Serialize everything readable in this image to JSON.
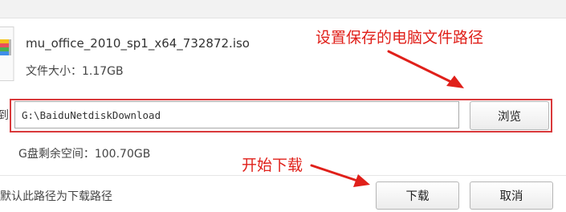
{
  "file": {
    "name": "mu_office_2010_sp1_x64_732872.iso",
    "size_label": "文件大小：",
    "size_value": "1.17GB"
  },
  "save_path": {
    "label": "到",
    "value": "G:\\BaiduNetdiskDownload",
    "browse_button": "浏览"
  },
  "free_space": {
    "label": "G盘剩余空间：",
    "value": "100.70GB"
  },
  "default_path": {
    "label": "默认此路径为下载路径",
    "checked": false
  },
  "actions": {
    "download_button": "下载",
    "cancel_button": "取消"
  },
  "annotations": {
    "save_path_note": "设置保存的电脑文件路径",
    "start_download_note": "开始下载"
  },
  "colors": {
    "annotation": "#e0201a",
    "highlight_box": "#d9393b",
    "button_border": "#b5b5b5"
  },
  "icons": {
    "file": "iso-file-icon",
    "annotation_arrows": "red-arrow-icon"
  }
}
